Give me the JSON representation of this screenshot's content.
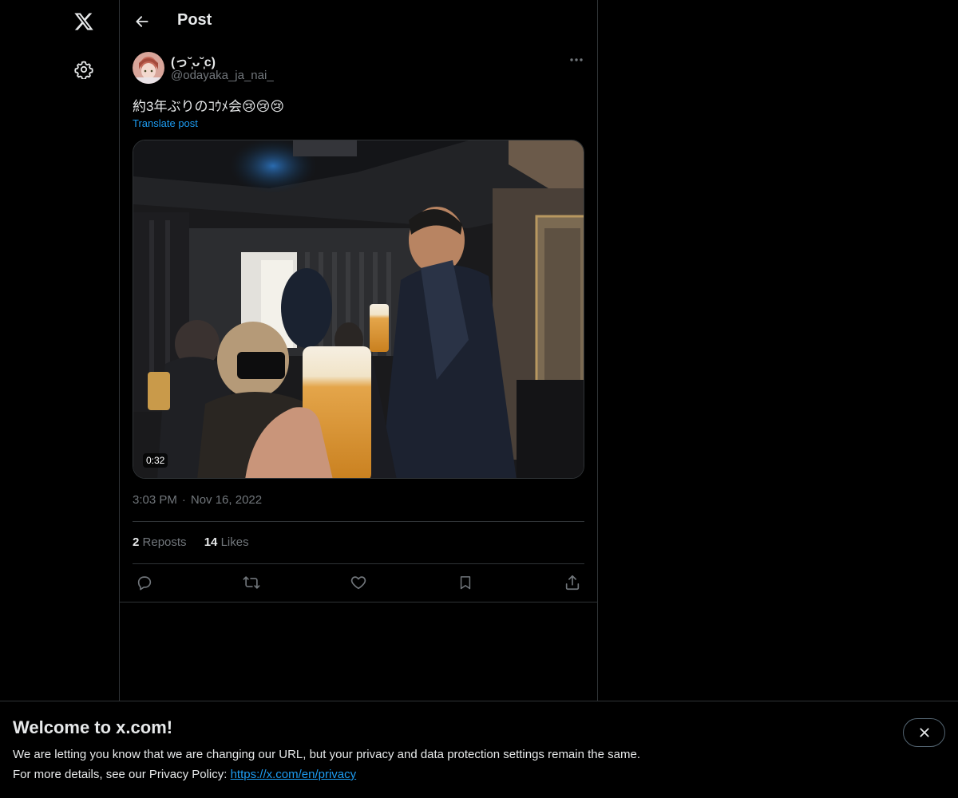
{
  "header": {
    "title": "Post",
    "back_icon": "arrow-left-icon"
  },
  "nav": {
    "logo_icon": "x-logo-icon",
    "settings_icon": "gear-icon"
  },
  "post": {
    "author": {
      "display_name": "(っ˘̩︎̩︎̩︎ᴗ˘̩︎̩︎̩︎c)",
      "handle": "@odayaka_ja_nai_"
    },
    "text": "約3年ぶりのｺｳﾒ会😢😢😢",
    "translate_label": "Translate post",
    "media": {
      "duration": "0:32"
    },
    "time": "3:03 PM",
    "separator": "·",
    "date": "Nov 16, 2022",
    "stats": {
      "reposts_count": "2",
      "reposts_label": "Reposts",
      "likes_count": "14",
      "likes_label": "Likes"
    },
    "actions": [
      "reply-icon",
      "repost-icon",
      "like-icon",
      "bookmark-icon",
      "share-icon"
    ]
  },
  "banner": {
    "title": "Welcome to x.com!",
    "line1": "We are letting you know that we are changing our URL, but your privacy and data protection settings remain the same.",
    "line2_prefix": "For more details, see our Privacy Policy: ",
    "link": "https://x.com/en/privacy",
    "close_icon": "close-icon"
  },
  "colors": {
    "background": "#000000",
    "text": "#e7e9ea",
    "secondary_text": "#71767b",
    "link": "#1d9bf0",
    "border": "#2f3336"
  }
}
